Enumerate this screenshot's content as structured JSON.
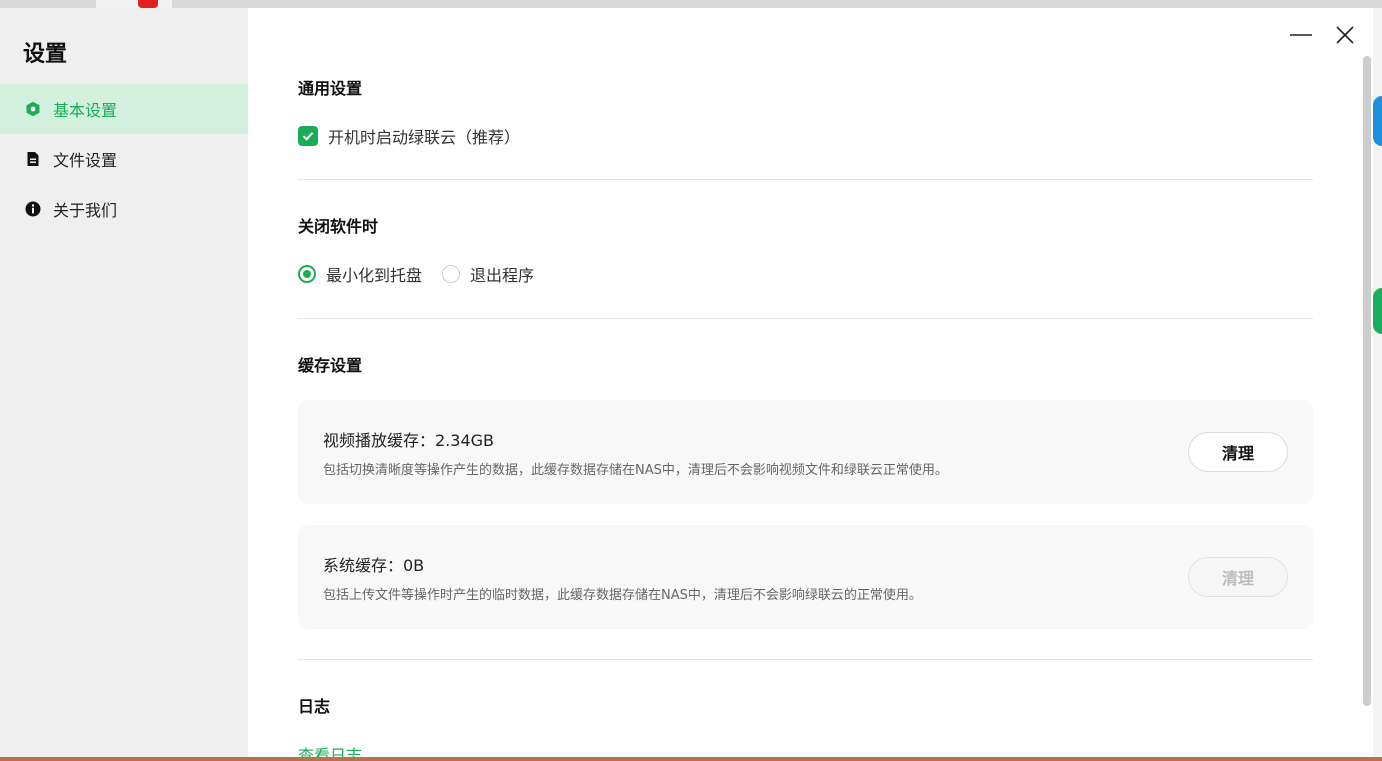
{
  "window": {
    "title": "设置",
    "accent_color": "#1aad55"
  },
  "sidebar": {
    "title": "设置",
    "items": [
      {
        "label": "基本设置",
        "icon": "shield-icon",
        "active": true
      },
      {
        "label": "文件设置",
        "icon": "document-icon",
        "active": false
      },
      {
        "label": "关于我们",
        "icon": "info-icon",
        "active": false
      }
    ]
  },
  "general": {
    "title": "通用设置",
    "autostart_label": "开机时启动绿联云（推荐）",
    "autostart_checked": true
  },
  "close_behavior": {
    "title": "关闭软件时",
    "options": [
      {
        "label": "最小化到托盘",
        "selected": true
      },
      {
        "label": "退出程序",
        "selected": false
      }
    ]
  },
  "cache": {
    "title": "缓存设置",
    "video": {
      "title": "视频播放缓存：2.34GB",
      "desc": "包括切换清晰度等操作产生的数据，此缓存数据存储在NAS中，清理后不会影响视频文件和绿联云正常使用。",
      "button": "清理",
      "enabled": true
    },
    "system": {
      "title": "系统缓存：0B",
      "desc": "包括上传文件等操作时产生的临时数据，此缓存数据存储在NAS中，清理后不会影响绿联云的正常使用。",
      "button": "清理",
      "enabled": false
    }
  },
  "log": {
    "title": "日志",
    "link": "查看日志"
  }
}
